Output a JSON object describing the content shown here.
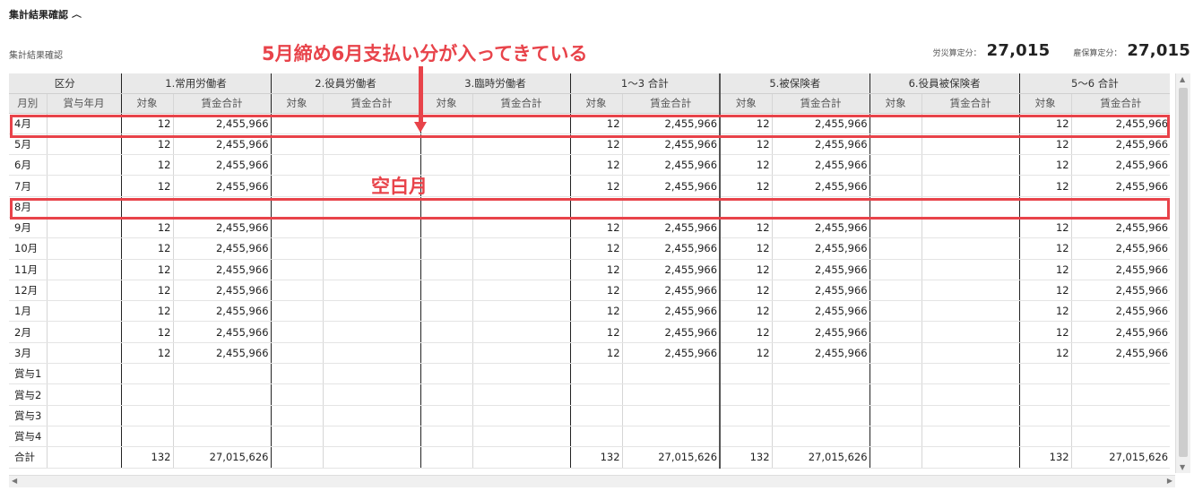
{
  "section": {
    "title": "集計結果確認",
    "subtitle": "集計結果確認"
  },
  "totals": {
    "rousai_label": "労災算定分：",
    "rousai_value": "27,015",
    "koyou_label": "雇保算定分：",
    "koyou_value": "27,015"
  },
  "table": {
    "group_headers": [
      "区分",
      "1.常用労働者",
      "2.役員労働者",
      "3.臨時労働者",
      "1〜3 合計",
      "5.被保険者",
      "6.役員被保険者",
      "5〜6 合計"
    ],
    "sub_headers": {
      "month_col": "月別",
      "bonus_col": "賞与年月",
      "count": "対象",
      "wage": "賃金合計"
    },
    "rows": [
      {
        "label": "4月",
        "v": [
          "12",
          "2,455,966",
          "",
          "",
          "",
          "",
          "12",
          "2,455,966",
          "12",
          "2,455,966",
          "",
          "",
          "12",
          "2,455,966"
        ]
      },
      {
        "label": "5月",
        "v": [
          "12",
          "2,455,966",
          "",
          "",
          "",
          "",
          "12",
          "2,455,966",
          "12",
          "2,455,966",
          "",
          "",
          "12",
          "2,455,966"
        ]
      },
      {
        "label": "6月",
        "v": [
          "12",
          "2,455,966",
          "",
          "",
          "",
          "",
          "12",
          "2,455,966",
          "12",
          "2,455,966",
          "",
          "",
          "12",
          "2,455,966"
        ]
      },
      {
        "label": "7月",
        "v": [
          "12",
          "2,455,966",
          "",
          "",
          "",
          "",
          "12",
          "2,455,966",
          "12",
          "2,455,966",
          "",
          "",
          "12",
          "2,455,966"
        ]
      },
      {
        "label": "8月",
        "v": [
          "",
          "",
          "",
          "",
          "",
          "",
          "",
          "",
          "",
          "",
          "",
          "",
          "",
          ""
        ]
      },
      {
        "label": "9月",
        "v": [
          "12",
          "2,455,966",
          "",
          "",
          "",
          "",
          "12",
          "2,455,966",
          "12",
          "2,455,966",
          "",
          "",
          "12",
          "2,455,966"
        ]
      },
      {
        "label": "10月",
        "v": [
          "12",
          "2,455,966",
          "",
          "",
          "",
          "",
          "12",
          "2,455,966",
          "12",
          "2,455,966",
          "",
          "",
          "12",
          "2,455,966"
        ]
      },
      {
        "label": "11月",
        "v": [
          "12",
          "2,455,966",
          "",
          "",
          "",
          "",
          "12",
          "2,455,966",
          "12",
          "2,455,966",
          "",
          "",
          "12",
          "2,455,966"
        ]
      },
      {
        "label": "12月",
        "v": [
          "12",
          "2,455,966",
          "",
          "",
          "",
          "",
          "12",
          "2,455,966",
          "12",
          "2,455,966",
          "",
          "",
          "12",
          "2,455,966"
        ]
      },
      {
        "label": "1月",
        "v": [
          "12",
          "2,455,966",
          "",
          "",
          "",
          "",
          "12",
          "2,455,966",
          "12",
          "2,455,966",
          "",
          "",
          "12",
          "2,455,966"
        ]
      },
      {
        "label": "2月",
        "v": [
          "12",
          "2,455,966",
          "",
          "",
          "",
          "",
          "12",
          "2,455,966",
          "12",
          "2,455,966",
          "",
          "",
          "12",
          "2,455,966"
        ]
      },
      {
        "label": "3月",
        "v": [
          "12",
          "2,455,966",
          "",
          "",
          "",
          "",
          "12",
          "2,455,966",
          "12",
          "2,455,966",
          "",
          "",
          "12",
          "2,455,966"
        ]
      },
      {
        "label": "賞与1",
        "v": [
          "",
          "",
          "",
          "",
          "",
          "",
          "",
          "",
          "",
          "",
          "",
          "",
          "",
          ""
        ]
      },
      {
        "label": "賞与2",
        "v": [
          "",
          "",
          "",
          "",
          "",
          "",
          "",
          "",
          "",
          "",
          "",
          "",
          "",
          ""
        ]
      },
      {
        "label": "賞与3",
        "v": [
          "",
          "",
          "",
          "",
          "",
          "",
          "",
          "",
          "",
          "",
          "",
          "",
          "",
          ""
        ]
      },
      {
        "label": "賞与4",
        "v": [
          "",
          "",
          "",
          "",
          "",
          "",
          "",
          "",
          "",
          "",
          "",
          "",
          "",
          ""
        ]
      },
      {
        "label": "合計",
        "v": [
          "132",
          "27,015,626",
          "",
          "",
          "",
          "",
          "132",
          "27,015,626",
          "132",
          "27,015,626",
          "",
          "",
          "132",
          "27,015,626"
        ]
      }
    ]
  },
  "annotations": {
    "note1": "5月締め6月支払い分が入ってきている",
    "note2": "空白月"
  },
  "colors": {
    "annotation": "#e8434a",
    "header_bg": "#e9e9e9"
  }
}
